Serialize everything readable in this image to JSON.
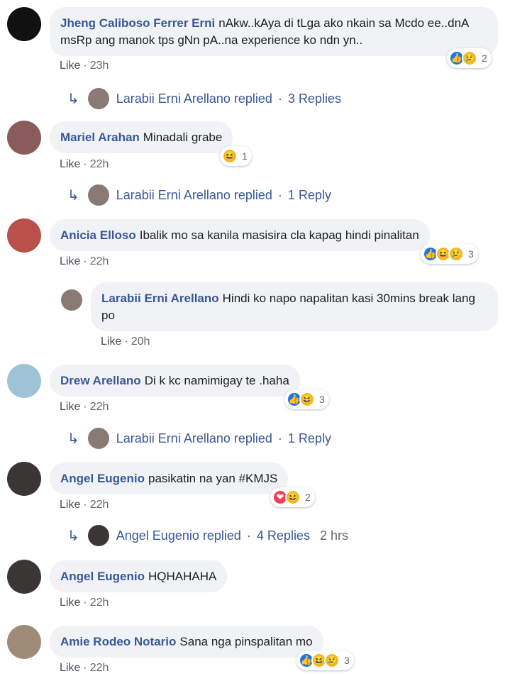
{
  "comments": [
    {
      "author": "Jheng Caliboso Ferrer Erni",
      "text": "nAkw..kAya di tLga ako nkain sa Mcdo ee..dnA msRp ang manok tps gNn pA..na experience ko ndn yn..",
      "like": "Like",
      "time": "23h",
      "reaction_count": "2",
      "replies": {
        "name": "Larabii Erni Arellano replied",
        "count": "3 Replies",
        "time": ""
      }
    },
    {
      "author": "Mariel Arahan",
      "text": "Minadali grabe",
      "like": "Like",
      "time": "22h",
      "reaction_count": "1",
      "replies": {
        "name": "Larabii Erni Arellano replied",
        "count": "1 Reply",
        "time": ""
      }
    },
    {
      "author": "Anicia Elloso",
      "text": "Ibalik mo sa kanila masisira cla kapag hindi pinalitan",
      "like": "Like",
      "time": "22h",
      "reaction_count": "3",
      "nested_reply": {
        "author": "Larabii Erni Arellano",
        "text": "Hindi ko napo napalitan kasi 30mins break lang po",
        "like": "Like",
        "time": "20h"
      }
    },
    {
      "author": "Drew Arellano",
      "text": "Di k kc namimigay te .haha",
      "like": "Like",
      "time": "22h",
      "reaction_count": "3",
      "replies": {
        "name": "Larabii Erni Arellano replied",
        "count": "1 Reply",
        "time": ""
      }
    },
    {
      "author": "Angel Eugenio",
      "text": "pasikatin na yan #KMJS",
      "like": "Like",
      "time": "22h",
      "reaction_count": "2",
      "replies": {
        "name": "Angel Eugenio replied",
        "count": "4 Replies",
        "time": "2 hrs"
      }
    },
    {
      "author": "Angel Eugenio",
      "text": "HQHAHAHA",
      "like": "Like",
      "time": "22h"
    },
    {
      "author": "Amie Rodeo Notario",
      "text": "Sana nga pinspalitan mo",
      "like": "Like",
      "time": "22h",
      "reaction_count": "3"
    }
  ],
  "separator": "·",
  "reply_arrow": "↳",
  "icons": {
    "like": "thumbs-up-icon",
    "sad": "sad-face-icon",
    "haha": "laughing-face-icon",
    "love": "heart-icon"
  },
  "colors": {
    "link": "#385898",
    "bubble": "#f0f2f5",
    "like_blue": "#1877f2",
    "emoji_yellow": "#f7b928",
    "love_red": "#f33e58"
  }
}
